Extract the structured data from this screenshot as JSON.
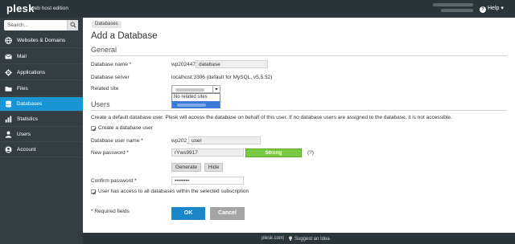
{
  "header": {
    "brand": "plesk",
    "edition": "web host edition",
    "help_label": "Help"
  },
  "sidebar": {
    "search_placeholder": "Search...",
    "items": [
      {
        "label": "Websites & Domains",
        "icon": "globe-icon"
      },
      {
        "label": "Mail",
        "icon": "mail-icon"
      },
      {
        "label": "Applications",
        "icon": "applications-icon"
      },
      {
        "label": "Files",
        "icon": "folder-icon"
      },
      {
        "label": "Databases",
        "icon": "database-icon",
        "active": true
      },
      {
        "label": "Statistics",
        "icon": "chart-icon"
      },
      {
        "label": "Users",
        "icon": "user-icon"
      },
      {
        "label": "Account",
        "icon": "account-icon"
      }
    ]
  },
  "main": {
    "breadcrumb": "Databases",
    "title": "Add a Database",
    "general": {
      "heading": "General",
      "db_name_label": "Database name *",
      "db_name_prefix": "wp202447_",
      "db_name_value": "database",
      "db_server_label": "Database server",
      "db_server_value": "localhost:3306 (default for MySQL, v5.5.52)",
      "related_site_label": "Related site",
      "dropdown_options": [
        "No related sites"
      ]
    },
    "users": {
      "heading": "Users",
      "description": "Create a default database user. Plesk will access the database on behalf of this user. If no database users are assigned to the database, it is not accessible.",
      "create_user_label": "Create a database user",
      "create_user_checked": true,
      "user_name_label": "Database user name *",
      "user_name_prefix": "wp202_",
      "user_name_value": "user",
      "password_label": "New password *",
      "password_value": "rYws9917",
      "strength": "Strong",
      "help_link": "(?)",
      "generate_label": "Generate",
      "hide_label": "Hide",
      "confirm_label": "Confirm password *",
      "confirm_value": "••••••••",
      "access_all_label": "User has access to all databases within the selected subscription",
      "access_all_checked": true
    },
    "required_note": "* Required fields",
    "ok_label": "OK",
    "cancel_label": "Cancel"
  },
  "footer": {
    "site_link": "plesk.com",
    "suggest_link": "Suggest an Idea"
  },
  "colors": {
    "accent": "#1a95d3",
    "sidebar": "#343d42",
    "topbar": "#2b3439",
    "strength": "#7ac943",
    "ok": "#1b87c9"
  }
}
